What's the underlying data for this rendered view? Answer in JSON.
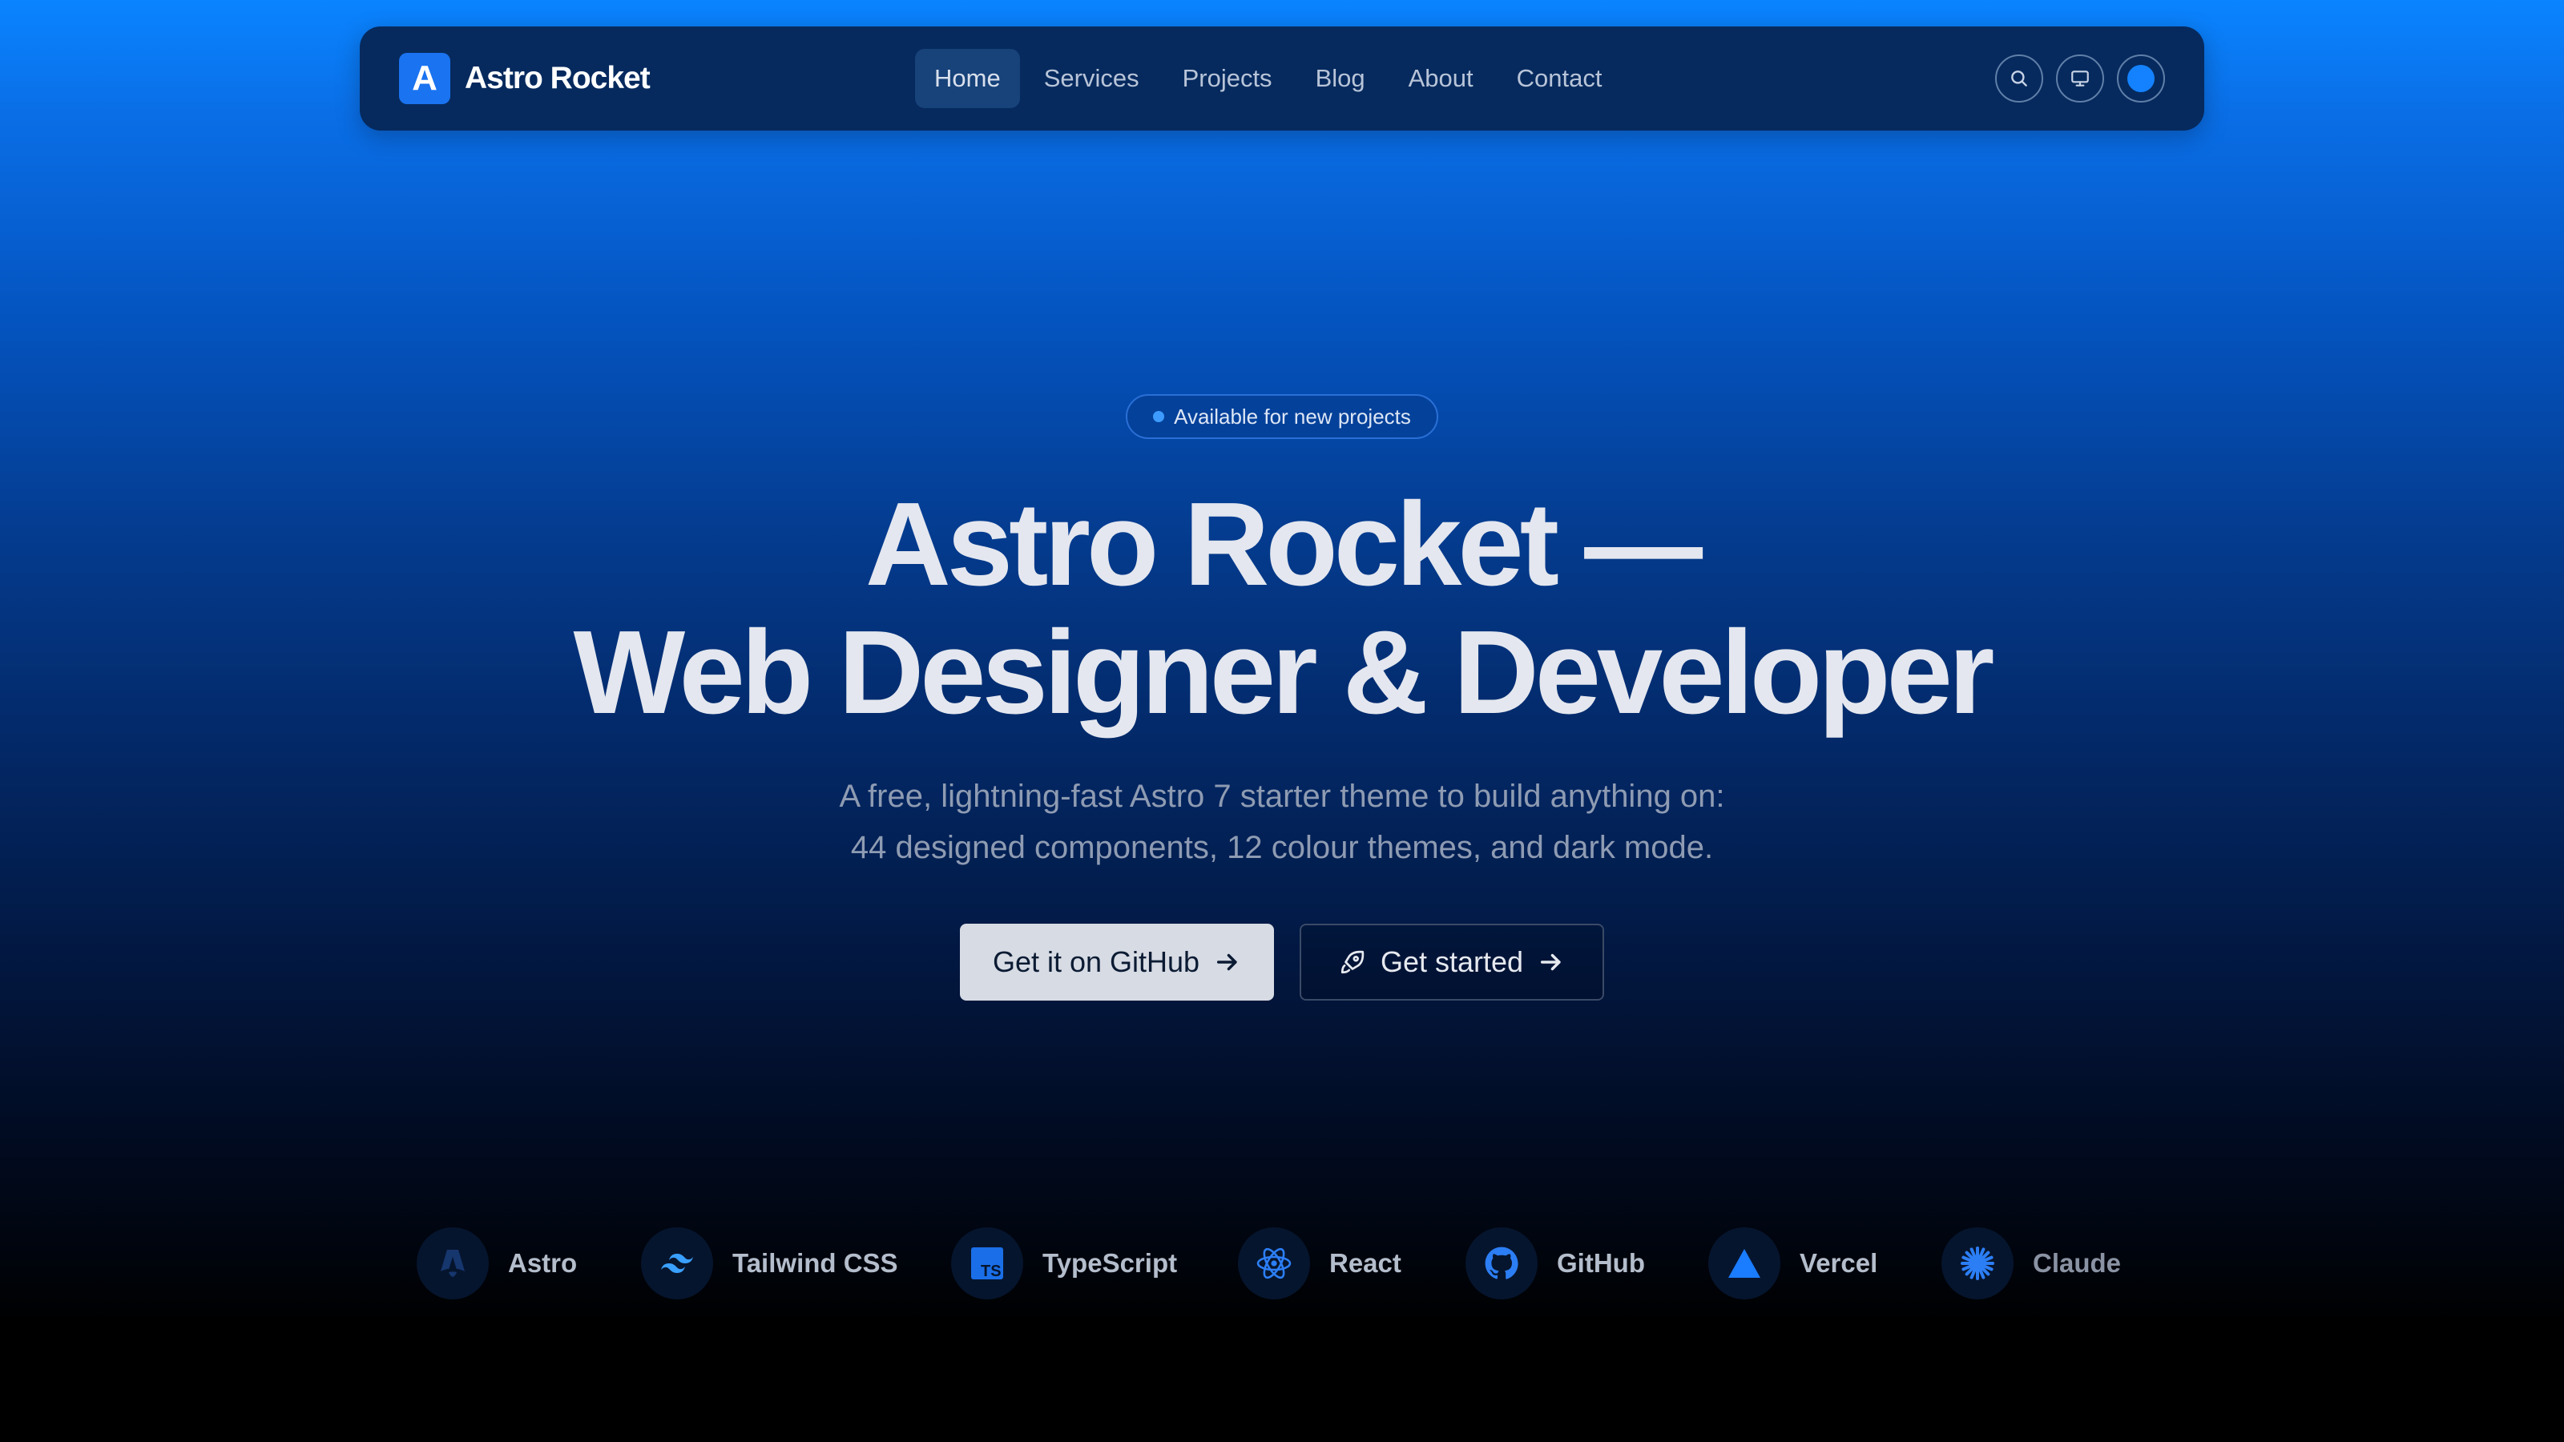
{
  "nav": {
    "brand_mark": "A",
    "brand_name": "Astro Rocket",
    "links": [
      {
        "label": "Home",
        "active": true
      },
      {
        "label": "Services"
      },
      {
        "label": "Projects"
      },
      {
        "label": "Blog"
      },
      {
        "label": "About"
      },
      {
        "label": "Contact"
      }
    ],
    "actions": [
      "search-icon",
      "monitor-icon",
      "theme-color-icon"
    ]
  },
  "hero": {
    "badge": "Available for new projects",
    "title_line1": "Astro Rocket —",
    "title_line2": "Web Designer & Developer",
    "subtitle_line1": "A free, lightning-fast Astro 7 starter theme to build anything on:",
    "subtitle_line2": "44 designed components, 12 colour themes, and dark mode.",
    "cta_primary": "Get it on GitHub",
    "cta_secondary": "Get started"
  },
  "tech": [
    {
      "label": "Astro",
      "icon": "astro-icon"
    },
    {
      "label": "Tailwind CSS",
      "icon": "tailwind-icon"
    },
    {
      "label": "TypeScript",
      "icon": "typescript-icon"
    },
    {
      "label": "React",
      "icon": "react-icon"
    },
    {
      "label": "GitHub",
      "icon": "github-icon"
    },
    {
      "label": "Vercel",
      "icon": "vercel-icon"
    },
    {
      "label": "Claude",
      "icon": "claude-icon"
    }
  ],
  "colors": {
    "accent": "#1482ff",
    "nav_bg": "#062a5e",
    "heading": "#e4e7ef"
  }
}
